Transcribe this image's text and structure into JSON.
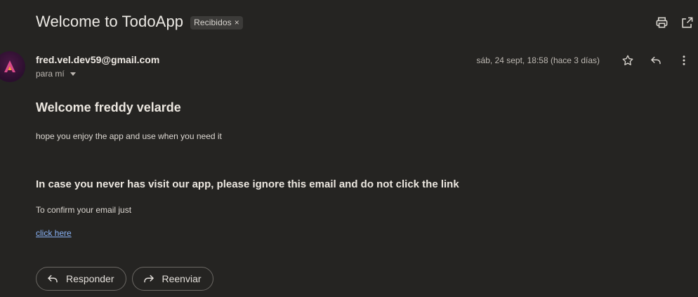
{
  "email": {
    "subject": "Welcome to TodoApp",
    "label": "Recibidos",
    "label_remove": "×",
    "sender": "fred.vel.dev59@gmail.com",
    "recipient_line": "para mí",
    "date": "sáb, 24 sept, 18:58 (hace 3 días)"
  },
  "body": {
    "heading": "Welcome freddy velarde",
    "intro": "hope you enjoy the app and use when you need it",
    "notice": "In case you never has visit our app, please ignore this email and do not click the link",
    "confirm_text": "To confirm your email just",
    "link_text": "click here"
  },
  "actions": {
    "reply_label": "Responder",
    "forward_label": "Reenviar"
  },
  "icons": {
    "print": "print-icon",
    "open_new": "open-in-new-window-icon",
    "star": "star-icon",
    "reply": "reply-icon",
    "more": "more-vert-icon",
    "forward": "forward-icon"
  },
  "colors": {
    "background": "#252422",
    "link": "#8ab4f8",
    "avatar_accent": "#e0397a"
  }
}
